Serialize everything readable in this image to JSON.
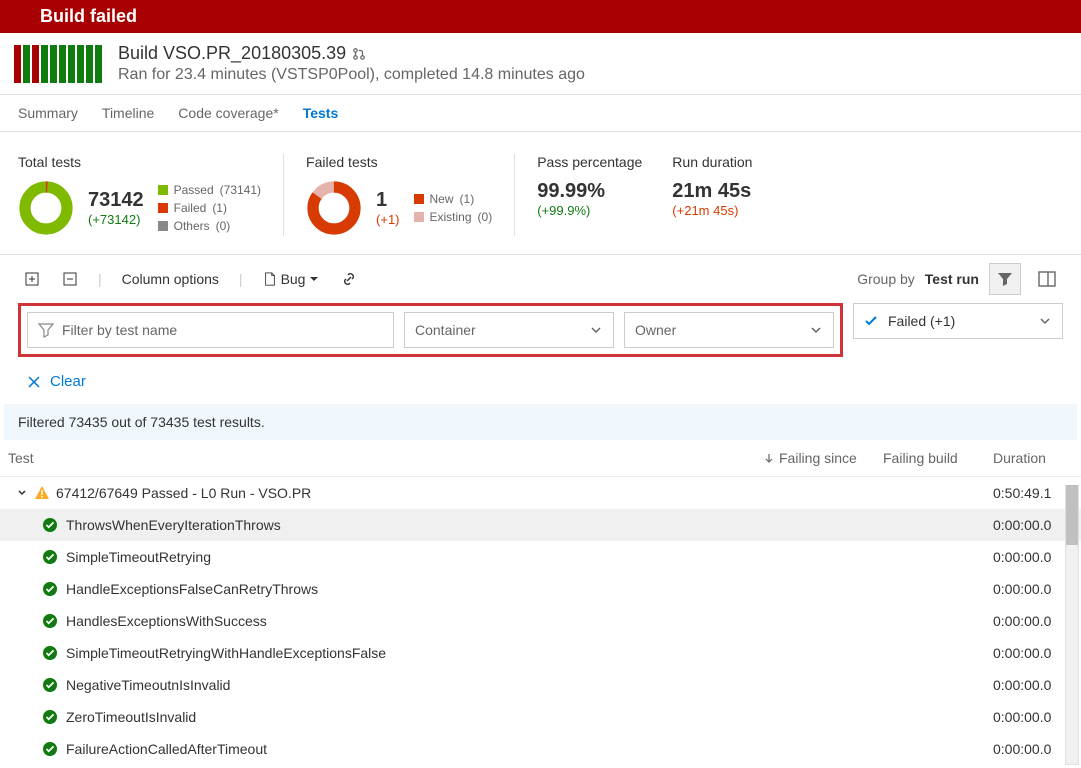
{
  "banner": {
    "title": "Build failed"
  },
  "build": {
    "title": "Build VSO.PR_20180305.39",
    "subtitle": "Ran for 23.4 minutes (VSTSP0Pool), completed 14.8 minutes ago"
  },
  "tabs": {
    "items": [
      "Summary",
      "Timeline",
      "Code coverage*",
      "Tests"
    ],
    "active": "Tests"
  },
  "stats": {
    "total": {
      "label": "Total tests",
      "value": "73142",
      "delta": "(+73142)",
      "legend": {
        "passed": {
          "label": "Passed",
          "count": "(73141)"
        },
        "failed": {
          "label": "Failed",
          "count": "(1)"
        },
        "others": {
          "label": "Others",
          "count": "(0)"
        }
      }
    },
    "failed": {
      "label": "Failed tests",
      "value": "1",
      "delta": "(+1)",
      "legend": {
        "new": {
          "label": "New",
          "count": "(1)"
        },
        "existing": {
          "label": "Existing",
          "count": "(0)"
        }
      }
    },
    "pass": {
      "label": "Pass percentage",
      "value": "99.99%",
      "delta": "(+99.9%)"
    },
    "duration": {
      "label": "Run duration",
      "value": "21m 45s",
      "delta": "(+21m 45s)"
    }
  },
  "toolbar": {
    "column_options": "Column options",
    "bug": "Bug",
    "group_by_label": "Group by",
    "group_by_value": "Test run"
  },
  "filters": {
    "search_placeholder": "Filter by test name",
    "container_label": "Container",
    "owner_label": "Owner",
    "status_label": "Failed (+1)",
    "clear_label": "Clear",
    "info": "Filtered 73435 out of 73435 test results."
  },
  "columns": {
    "test": "Test",
    "failing_since": "Failing since",
    "failing_build": "Failing build",
    "duration": "Duration"
  },
  "group": {
    "title": "67412/67649 Passed - L0 Run - VSO.PR",
    "duration": "0:50:49.1"
  },
  "tests": [
    {
      "name": "ThrowsWhenEveryIterationThrows",
      "duration": "0:00:00.0"
    },
    {
      "name": "SimpleTimeoutRetrying",
      "duration": "0:00:00.0"
    },
    {
      "name": "HandleExceptionsFalseCanRetryThrows",
      "duration": "0:00:00.0"
    },
    {
      "name": "HandlesExceptionsWithSuccess",
      "duration": "0:00:00.0"
    },
    {
      "name": "SimpleTimeoutRetryingWithHandleExceptionsFalse",
      "duration": "0:00:00.0"
    },
    {
      "name": "NegativeTimeoutnIsInvalid",
      "duration": "0:00:00.0"
    },
    {
      "name": "ZeroTimeoutIsInvalid",
      "duration": "0:00:00.0"
    },
    {
      "name": "FailureActionCalledAfterTimeout",
      "duration": "0:00:00.0"
    }
  ]
}
